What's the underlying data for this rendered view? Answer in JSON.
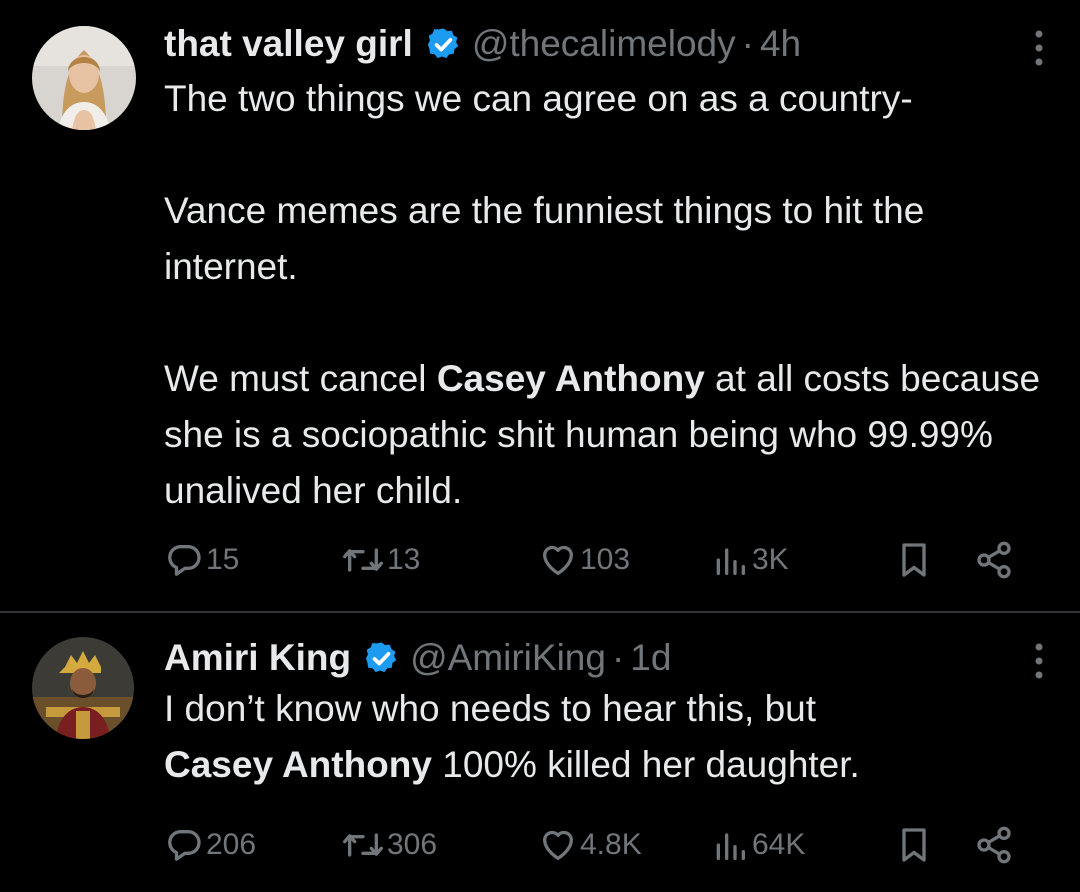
{
  "tweets": [
    {
      "name": "that valley girl",
      "handle": "@thecalimelody",
      "separator": "·",
      "time": "4h",
      "body": {
        "line1": "The two things we can agree on as a country-",
        "para2": "Vance memes are the funniest things to hit the internet.",
        "para3_before": "We must cancel ",
        "para3_bold": "Casey Anthony",
        "para3_after": " at all costs because she is a sociopathic shit human being who 99.99% unalived her child."
      },
      "stats": {
        "replies": "15",
        "reposts": "13",
        "likes": "103",
        "views": "3K"
      }
    },
    {
      "name": "Amiri King",
      "handle": "@AmiriKing",
      "separator": "·",
      "time": "1d",
      "body": {
        "line1": "I don’t know who needs to hear this, but",
        "line2_bold": "Casey Anthony",
        "line2_after": " 100% killed her daughter."
      },
      "stats": {
        "replies": "206",
        "reposts": "306",
        "likes": "4.8K",
        "views": "64K"
      }
    }
  ],
  "colors": {
    "background": "#000000",
    "text": "#e7e9ea",
    "muted": "#71767b",
    "verified": "#1d9bf0",
    "divider": "#2f3336"
  },
  "icons": [
    "verified-badge-icon",
    "more-icon",
    "reply-icon",
    "repost-icon",
    "like-icon",
    "views-icon",
    "bookmark-icon",
    "share-icon"
  ]
}
